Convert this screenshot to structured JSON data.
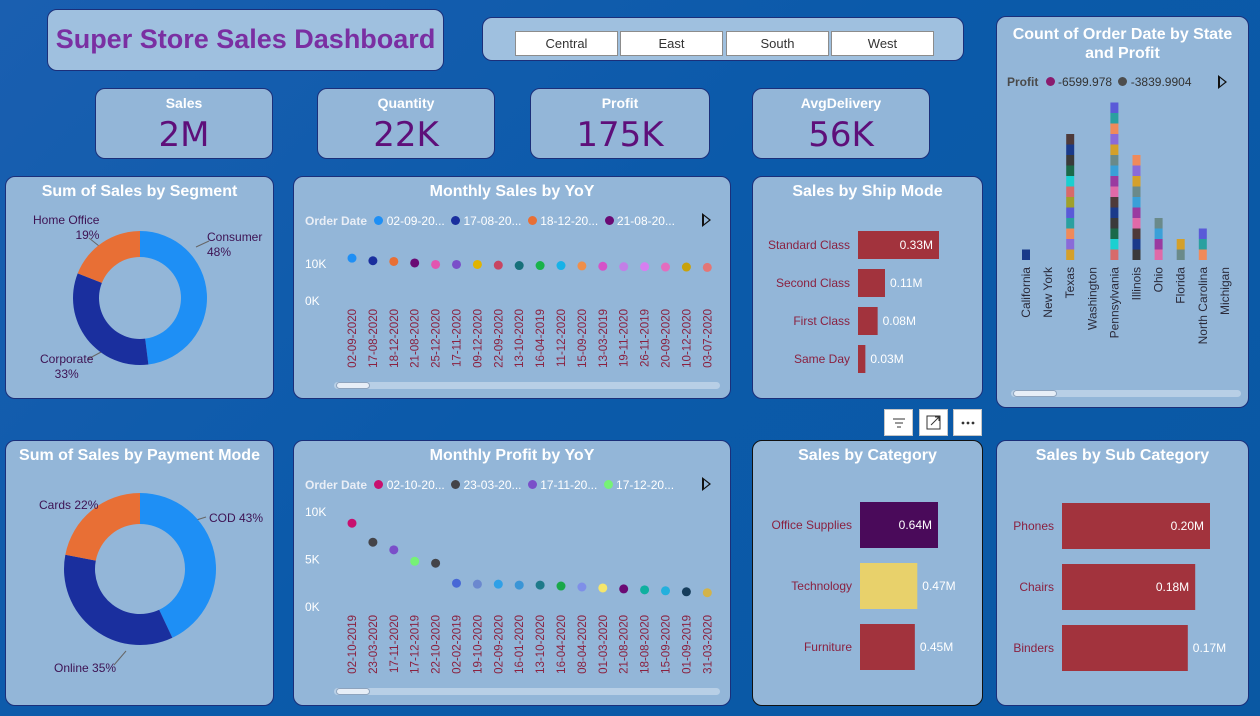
{
  "title": "Super Store Sales Dashboard",
  "regions": [
    "Central",
    "East",
    "South",
    "West"
  ],
  "kpis": [
    {
      "label": "Sales",
      "value": "2M"
    },
    {
      "label": "Quantity",
      "value": "22K"
    },
    {
      "label": "Profit",
      "value": "175K"
    },
    {
      "label": "AvgDelivery",
      "value": "56K"
    }
  ],
  "icons": {
    "filter": "filter-icon",
    "focus": "focus-mode-icon",
    "more": "more-options-icon",
    "next": "legend-next-icon"
  },
  "colors": {
    "accent_title": "#6b2f9e",
    "kpi_value": "#5e0f7a",
    "bar_red": "#a2333d",
    "card_bg": "#93b6d8",
    "donut_blue": "#1e8ff5",
    "donut_navy": "#1a2f9e",
    "donut_orange": "#e86f35"
  },
  "segment_chart": {
    "title": "Sum of Sales by Segment",
    "chart_data": {
      "type": "pie",
      "labels": [
        "Consumer",
        "Corporate",
        "Home Office"
      ],
      "values": [
        48,
        33,
        19
      ],
      "display": [
        "48%",
        "33%",
        "19%"
      ]
    }
  },
  "payment_chart": {
    "title": "Sum of Sales by Payment Mode",
    "chart_data": {
      "type": "pie",
      "labels": [
        "COD",
        "Online",
        "Cards"
      ],
      "values": [
        43,
        35,
        22
      ],
      "display": [
        "COD 43%",
        "Online 35%",
        "Cards 22%"
      ]
    }
  },
  "monthly_sales": {
    "title": "Monthly Sales by YoY",
    "legend_label": "Order Date",
    "legend_items": [
      "02-09-20...",
      "17-08-20...",
      "18-12-20...",
      "21-08-20..."
    ],
    "y_ticks": [
      "10K",
      "0K"
    ],
    "chart_data": {
      "type": "scatter",
      "x": [
        "02-09-2020",
        "17-08-2020",
        "18-12-2020",
        "21-08-2020",
        "25-12-2020",
        "17-11-2020",
        "09-12-2020",
        "22-09-2020",
        "13-10-2020",
        "16-04-2019",
        "11-12-2020",
        "15-09-2020",
        "13-03-2019",
        "19-11-2020",
        "26-11-2019",
        "20-09-2020",
        "10-12-2020",
        "03-07-2020"
      ],
      "y": [
        11600,
        10900,
        10700,
        10300,
        9900,
        9900,
        9900,
        9700,
        9600,
        9600,
        9600,
        9500,
        9400,
        9300,
        9300,
        9200,
        9200,
        9100
      ],
      "colors": [
        "#1e8ff5",
        "#1a2f9e",
        "#e86f35",
        "#6a0a74",
        "#e255b0",
        "#7a4fc9",
        "#e1b400",
        "#c84562",
        "#17707a",
        "#1ab34a",
        "#17b2e8",
        "#ef8f4b",
        "#d553c8",
        "#c27fe6",
        "#d77ff0",
        "#e36dbf",
        "#c9a20a",
        "#e47676"
      ],
      "ylim": [
        0,
        13000
      ]
    }
  },
  "monthly_profit": {
    "title": "Monthly Profit by YoY",
    "legend_label": "Order Date",
    "legend_items": [
      "02-10-20...",
      "23-03-20...",
      "17-11-20...",
      "17-12-20..."
    ],
    "y_ticks": [
      "10K",
      "5K",
      "0K"
    ],
    "chart_data": {
      "type": "scatter",
      "x": [
        "02-10-2019",
        "23-03-2020",
        "17-11-2020",
        "17-12-2019",
        "22-10-2020",
        "02-02-2019",
        "19-10-2020",
        "02-09-2020",
        "16-01-2020",
        "13-10-2020",
        "16-04-2020",
        "08-04-2020",
        "01-03-2020",
        "21-08-2020",
        "18-08-2020",
        "15-09-2020",
        "01-09-2019",
        "31-03-2020"
      ],
      "y": [
        8800,
        6800,
        6000,
        4800,
        4600,
        2500,
        2400,
        2400,
        2300,
        2300,
        2200,
        2100,
        2000,
        1900,
        1800,
        1700,
        1600,
        1500
      ],
      "colors": [
        "#c8106f",
        "#444449",
        "#7a4fc9",
        "#76f276",
        "#444449",
        "#4868d6",
        "#6b88cf",
        "#2fa0e7",
        "#3a95d6",
        "#1f7a8a",
        "#1aa84a",
        "#7f8fe8",
        "#f5e66b",
        "#6a0a74",
        "#0fb0a0",
        "#23b0dd",
        "#163d5c",
        "#d2b34a"
      ],
      "ylim": [
        0,
        10500
      ]
    }
  },
  "ship_mode": {
    "title": "Sales by Ship Mode",
    "chart_data": {
      "type": "bar",
      "categories": [
        "Standard Class",
        "Second Class",
        "First Class",
        "Same Day"
      ],
      "values": [
        0.33,
        0.11,
        0.08,
        0.03
      ],
      "display": [
        "0.33M",
        "0.11M",
        "0.08M",
        "0.03M"
      ],
      "unit": "M"
    }
  },
  "category": {
    "title": "Sales by Category",
    "chart_data": {
      "type": "bar",
      "categories": [
        "Office Supplies",
        "Technology",
        "Furniture"
      ],
      "values": [
        0.64,
        0.47,
        0.45
      ],
      "display": [
        "0.64M",
        "0.47M",
        "0.45M"
      ],
      "colors": [
        "#4a0a5a",
        "#e8d16b",
        "#a2333d"
      ],
      "unit": "M"
    }
  },
  "sub_category": {
    "title": "Sales by Sub Category",
    "chart_data": {
      "type": "bar",
      "categories": [
        "Phones",
        "Chairs",
        "Binders"
      ],
      "values": [
        0.2,
        0.18,
        0.17
      ],
      "display": [
        "0.20M",
        "0.18M",
        "0.17M"
      ],
      "unit": "M"
    }
  },
  "state_chart": {
    "title_line1": "Count of Order Date by State",
    "title_line2": "and Profit",
    "legend_label": "Profit",
    "legend_items": [
      {
        "label": "-6599.978",
        "color": "#8a1b6e"
      },
      {
        "label": "-3839.9904",
        "color": "#4d4d4d"
      }
    ],
    "chart_data": {
      "type": "bar",
      "stacked": true,
      "categories": [
        "California",
        "New York",
        "Texas",
        "Washington",
        "Pennsylvania",
        "Illinois",
        "Ohio",
        "Florida",
        "North Carolina",
        "Michigan"
      ],
      "values": [
        1,
        0,
        12,
        0,
        15,
        10,
        4,
        2,
        3,
        0
      ]
    }
  }
}
